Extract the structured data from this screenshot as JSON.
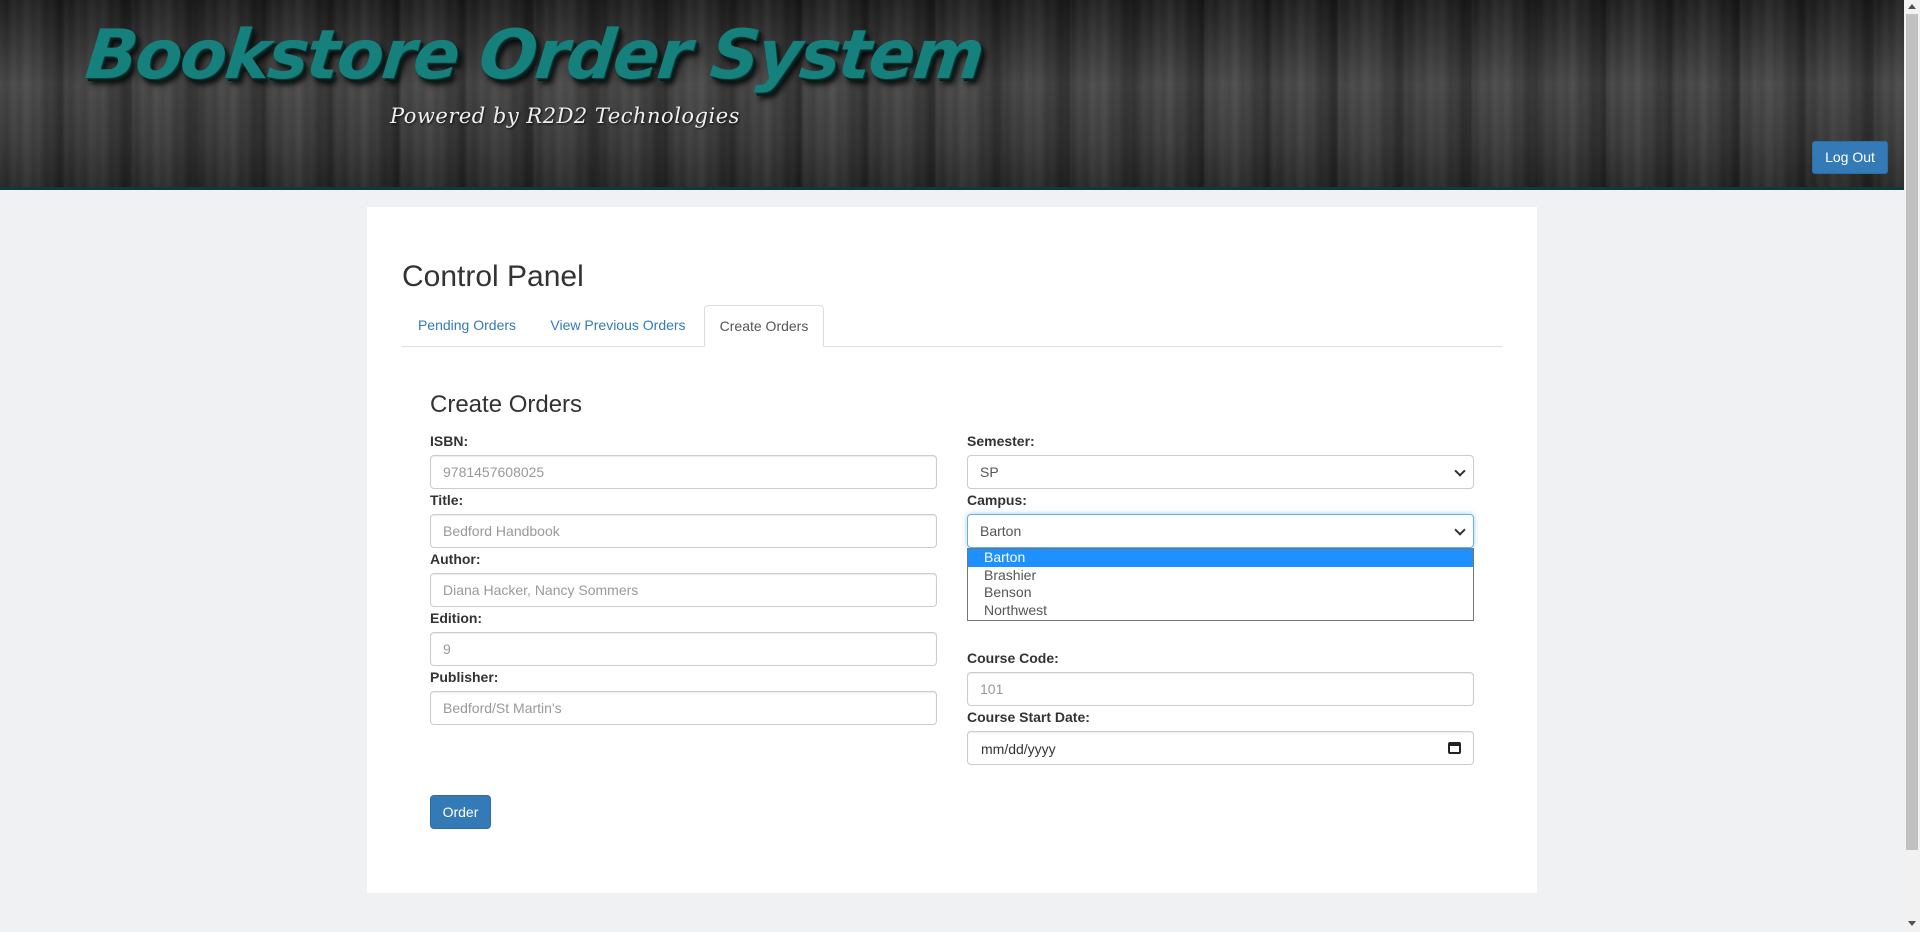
{
  "header": {
    "title": "Bookstore Order System",
    "subtitle": "Powered by R2D2 Technologies",
    "logout_label": "Log Out"
  },
  "page": {
    "title": "Control Panel",
    "tabs": [
      {
        "label": "Pending Orders"
      },
      {
        "label": "View Previous Orders"
      },
      {
        "label": "Create Orders"
      }
    ],
    "active_tab": "Create Orders"
  },
  "form": {
    "title": "Create Orders",
    "isbn": {
      "label": "ISBN:",
      "placeholder": "9781457608025"
    },
    "book_title": {
      "label": "Title:",
      "placeholder": "Bedford Handbook"
    },
    "author": {
      "label": "Author:",
      "placeholder": "Diana Hacker, Nancy Sommers"
    },
    "edition": {
      "label": "Edition:",
      "placeholder": "9"
    },
    "publisher": {
      "label": "Publisher:",
      "placeholder": "Bedford/St Martin's"
    },
    "semester": {
      "label": "Semester:",
      "value": "SP"
    },
    "campus": {
      "label": "Campus:",
      "value": "Barton",
      "options": [
        "Barton",
        "Brashier",
        "Benson",
        "Northwest"
      ],
      "dropdown_open": true
    },
    "course_code": {
      "label": "Course Code:",
      "placeholder": "101"
    },
    "course_start_date": {
      "label": "Course Start Date:",
      "placeholder": "mm/dd/yyyy"
    },
    "order_label": "Order"
  },
  "colors": {
    "accent": "#337ab7",
    "logo_teal": "#16807c",
    "dropdown_highlight": "#1e90ff"
  }
}
